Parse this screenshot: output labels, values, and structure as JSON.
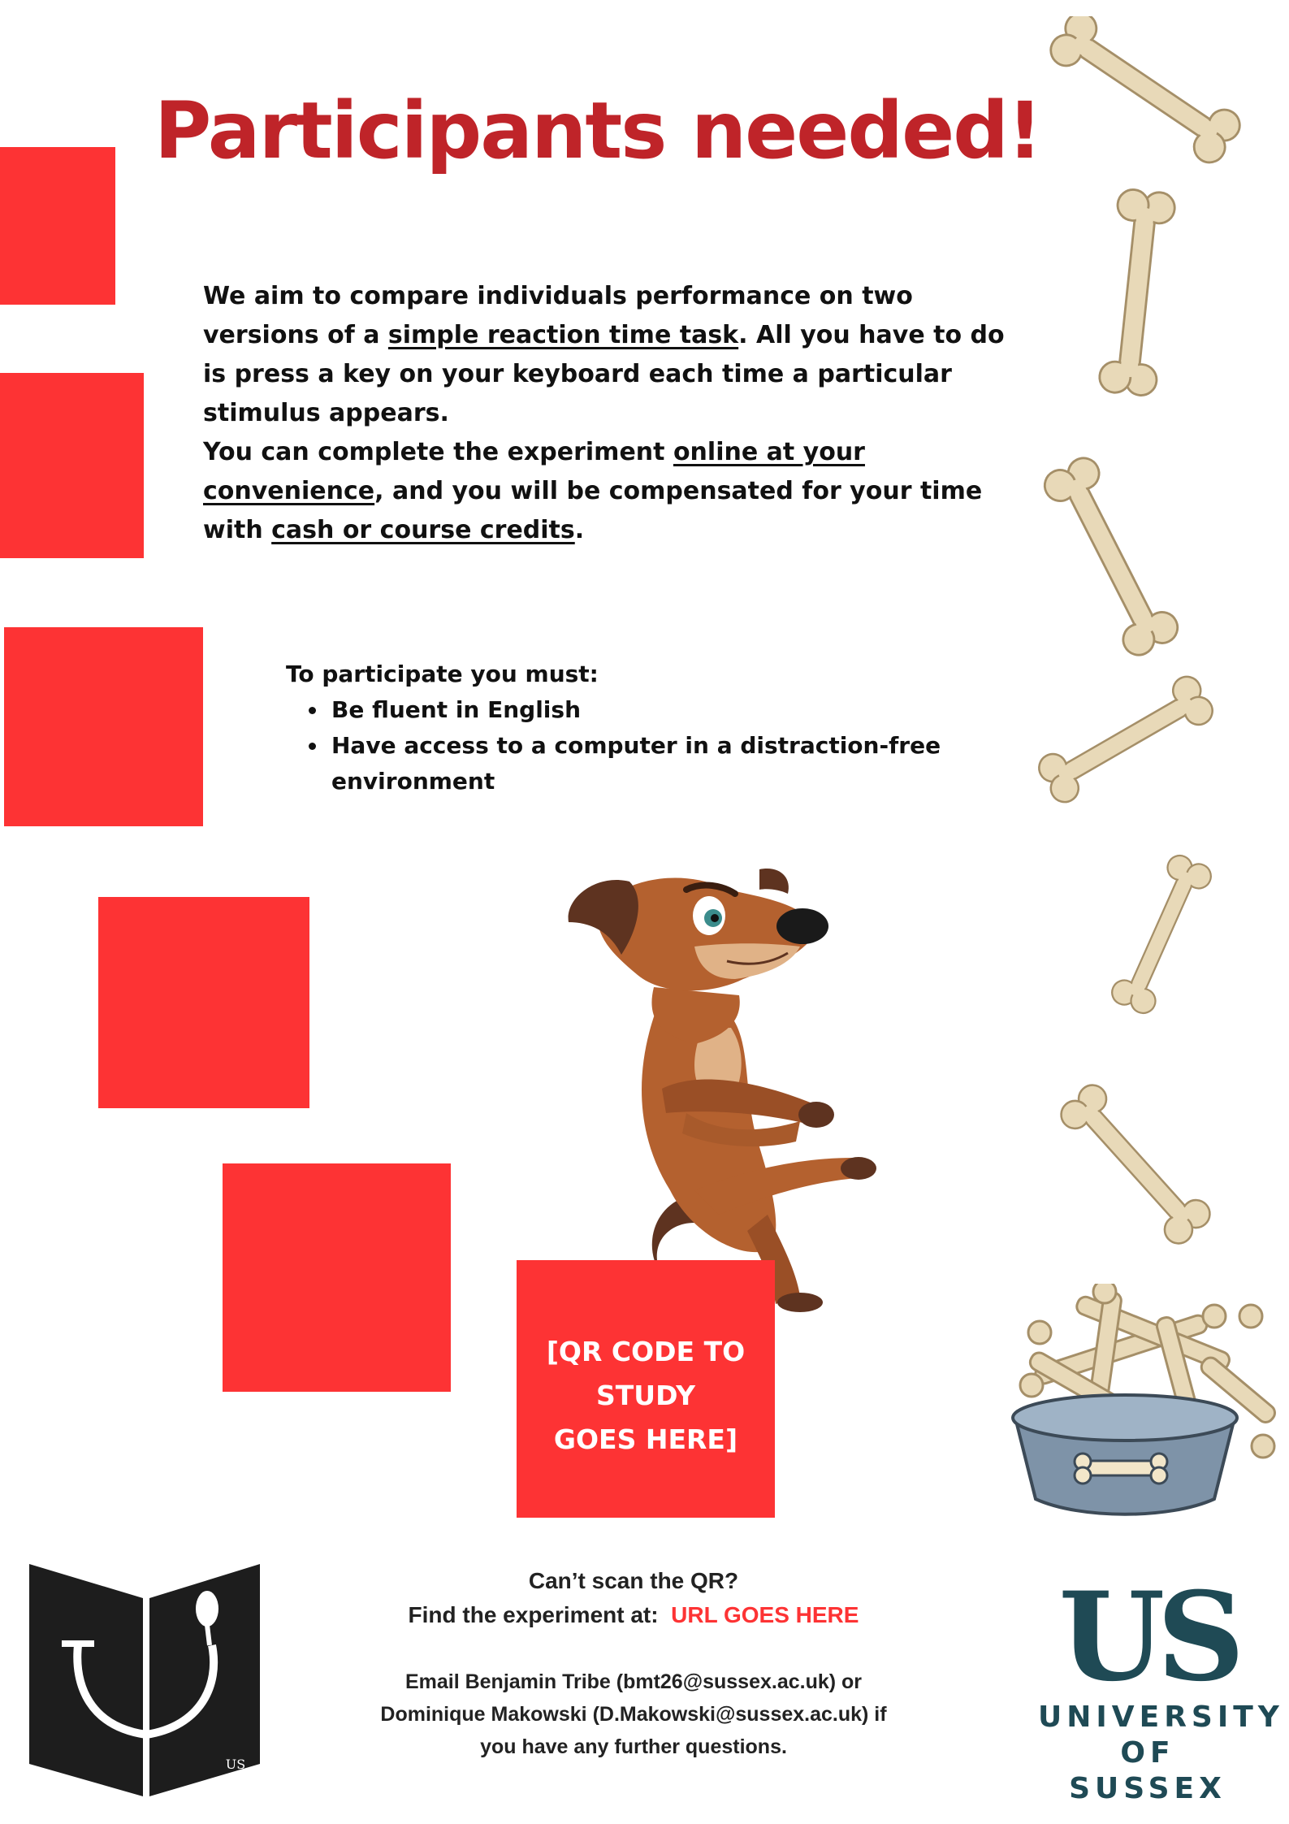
{
  "poster": {
    "title": "Participants needed!",
    "paragraph1": {
      "part1": "We aim to compare individuals performance on two versions of a ",
      "link1": "simple reaction time task",
      "part2": ". All you have to do is press a key on your keyboard each time a particular stimulus appears."
    },
    "paragraph2": {
      "part1": "You can complete the experiment ",
      "link1": "online at your convenience",
      "part2": ", and you will be compensated for your time with ",
      "link2": "cash or course credits",
      "part3": "."
    },
    "requirements": {
      "heading": "To participate you must:",
      "items": [
        "Be fluent in English",
        "Have access to a computer in a distraction-free environment"
      ]
    },
    "qr_placeholder": {
      "line1": "[QR CODE TO",
      "line2": "STUDY",
      "line3": "GOES HERE]"
    },
    "footer": {
      "cant_scan": "Can’t scan the QR?",
      "find_label": "Find the experiment at:",
      "url": "URL GOES HERE",
      "contact_line1": "Email Benjamin Tribe (bmt26@sussex.ac.uk) or",
      "contact_line2": "Dominique Makowski  (D.Makowski@sussex.ac.uk) if",
      "contact_line3": "you have any further questions."
    },
    "logos": {
      "us_monogram": "US",
      "university_line1": "UNIVERSITY",
      "university_line2": "OF SUSSEX",
      "psi_logo_small_text": "US"
    },
    "colors": {
      "title_red": "#bf2429",
      "square_red": "#fd3334",
      "sussex_teal": "#1f4a55",
      "bone": "#e8d9b8"
    },
    "icons": [
      "bone-icon",
      "dog-illustration",
      "bone-bowl-illustration",
      "psi-logo",
      "sussex-logo"
    ]
  }
}
